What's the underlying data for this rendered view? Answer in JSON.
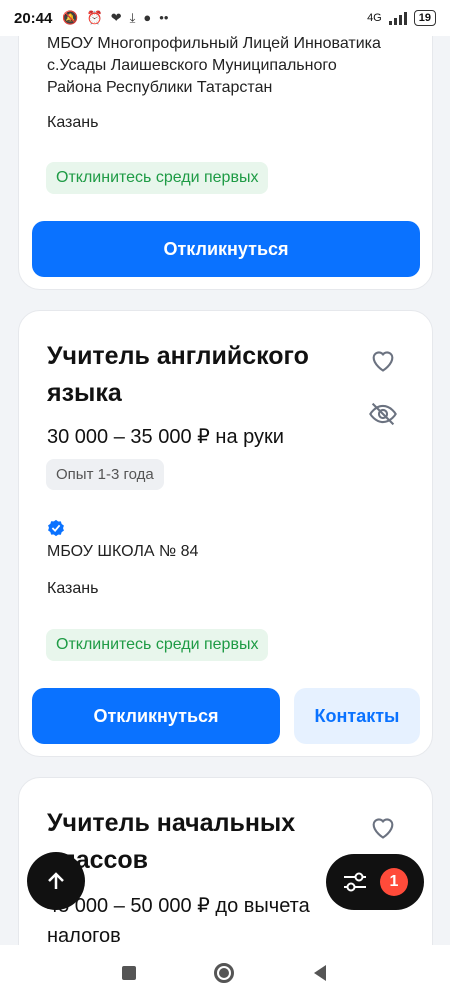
{
  "status_bar": {
    "time": "20:44",
    "network": "4G",
    "battery": "19"
  },
  "cards": [
    {
      "employer_lines": [
        "МБОУ Многопрофильный Лицей Инноватика",
        "с.Усады Лаишевского Муниципального",
        "Района Республики Татарстан"
      ],
      "city": "Казань",
      "badge": "Отклинитесь среди первых",
      "respond_label": "Откликнуться"
    },
    {
      "title": "Учитель английского языка",
      "salary": "30 000 – 35 000 ₽ на руки",
      "experience": "Опыт 1-3 года",
      "employer": "МБОУ ШКОЛА № 84",
      "city": "Казань",
      "badge": "Отклинитесь среди первых",
      "respond_label": "Откликнуться",
      "contacts_label": "Контакты"
    },
    {
      "title": "Учитель начальных классов",
      "salary": "45 000 – 50 000 ₽ до вычета налогов"
    }
  ],
  "filter": {
    "count": "1"
  },
  "colors": {
    "accent": "#0a72ff",
    "success": "#1e9b45",
    "badge_red": "#ff4b3a"
  }
}
